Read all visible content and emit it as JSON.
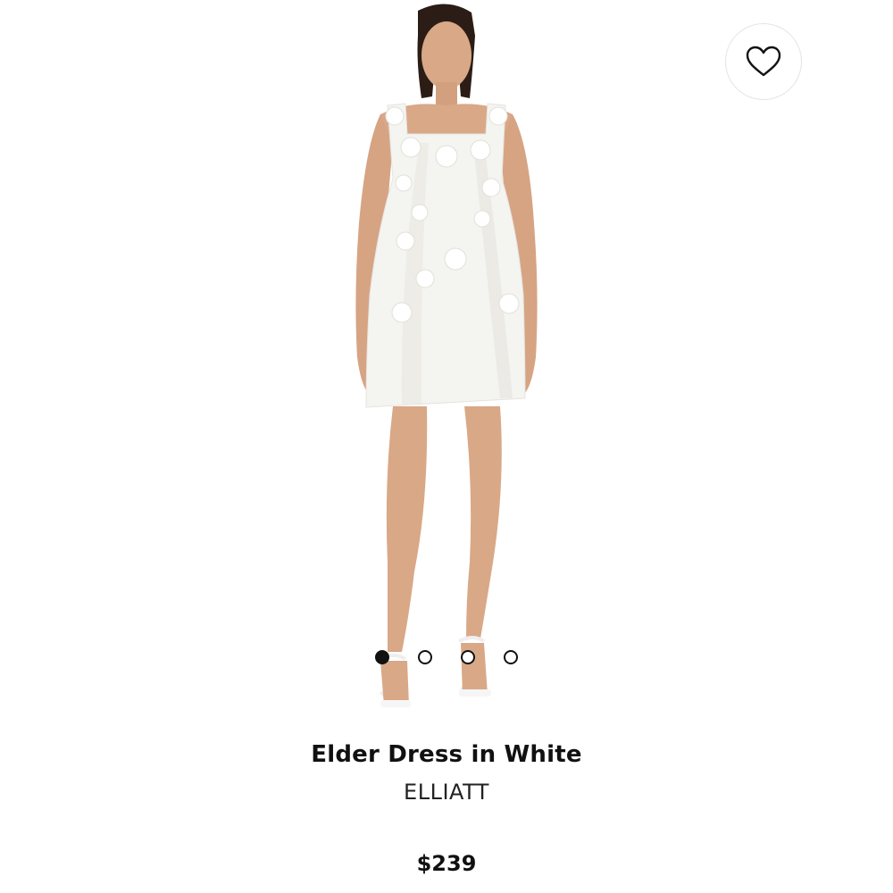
{
  "product": {
    "name": "Elder Dress in White",
    "brand": "ELLIATT",
    "price": "$239"
  },
  "wishlist": {
    "icon": "heart-outline-icon"
  },
  "carousel": {
    "image_count": 4,
    "active_index": 0
  },
  "colors": {
    "text": "#111111",
    "background": "#ffffff",
    "dress": "#f4f4f1",
    "skin": "#d9a887"
  }
}
